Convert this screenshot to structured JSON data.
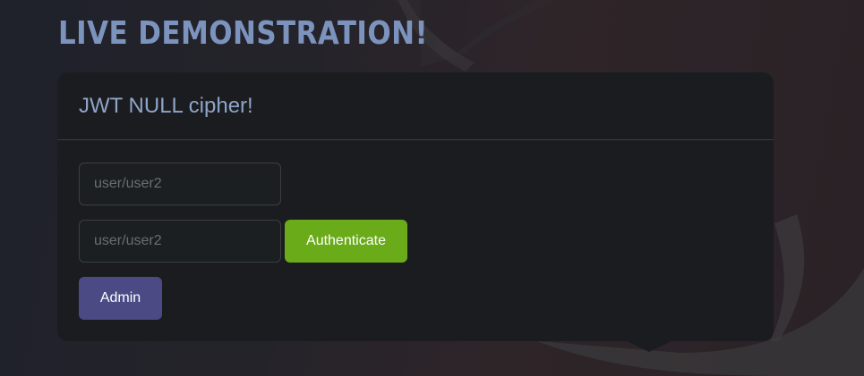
{
  "page": {
    "title": "LIVE DEMONSTRATION!"
  },
  "card": {
    "title": "JWT NULL cipher!",
    "username_placeholder": "user/user2",
    "username_value": "",
    "password_placeholder": "user/user2",
    "password_value": "",
    "authenticate_label": "Authenticate",
    "admin_label": "Admin"
  },
  "colors": {
    "title": "#7b93bd",
    "card_background": "#1b1c1f",
    "authenticate_button": "#6aab1a",
    "admin_button": "#4b4a85"
  }
}
